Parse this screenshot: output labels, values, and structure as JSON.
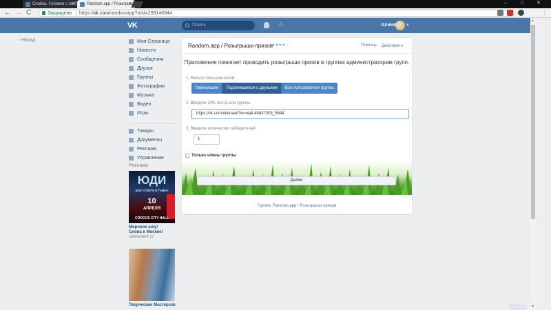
{
  "browser": {
    "tabs": [
      {
        "label": "Спайка. Готовим с люб"
      },
      {
        "label": "Random.app / Розыгрыш"
      }
    ],
    "secure_label": "Защищено",
    "url_prefix": "https://",
    "url_domain": "vk.com",
    "url_rest": "/randomapp?mid=299146944",
    "back_glyph": "←",
    "forward_glyph": "→",
    "reload_glyph": "C",
    "minimize_glyph": "–",
    "maximize_glyph": "□",
    "close_glyph": "✕",
    "tab_close_glyph": "×"
  },
  "vk": {
    "logo": "VK",
    "search_placeholder": "Поиск",
    "user_name": "Алина",
    "music_glyph": "♫",
    "chevron_glyph": "▾"
  },
  "back_link": "‹  Назад",
  "left_nav": {
    "primary": [
      {
        "label": "Моя Страница",
        "icon": "home-icon"
      },
      {
        "label": "Новости",
        "icon": "news-icon"
      },
      {
        "label": "Сообщения",
        "icon": "messages-icon"
      },
      {
        "label": "Друзья",
        "icon": "friends-icon"
      },
      {
        "label": "Группы",
        "icon": "groups-icon"
      },
      {
        "label": "Фотографии",
        "icon": "photos-icon"
      },
      {
        "label": "Музыка",
        "icon": "music-icon"
      },
      {
        "label": "Видео",
        "icon": "video-icon"
      },
      {
        "label": "Игры",
        "icon": "games-icon"
      }
    ],
    "secondary": [
      {
        "label": "Товары",
        "icon": "goods-icon"
      },
      {
        "label": "Документы",
        "icon": "documents-icon"
      },
      {
        "label": "Реклама",
        "icon": "ads-icon"
      },
      {
        "label": "Управление",
        "icon": "manage-icon"
      }
    ]
  },
  "ads": {
    "title": "Реклама",
    "ad1": {
      "headline": "ЮДИ",
      "subline": "шоу «Света и Тьмы»",
      "day": "10",
      "month": "АПРЕЛЯ",
      "venue": "CROCUS CITY HALL",
      "caption_line1": "Мировое шоу!",
      "caption_line2": "Снова в Москве!",
      "domain": "salesevent.ru"
    },
    "ad2": {
      "caption": "Творческие Мастерски"
    }
  },
  "app": {
    "title": "Random.app / Розыгрыши призов",
    "stars": "★★★★☆",
    "help": "Помощь",
    "actions": "Действия ▾",
    "intro": "Приложение помогает проводить розыгрыши призов в группах администраторам групп.",
    "filter_label": "1. Фильтр пользователей:",
    "filter_options": [
      "Лайкнувшие",
      "Поделившиеся с друзьями",
      "Все пользователи группы"
    ],
    "filter_selected_index": 1,
    "url_label": "2. Введите URL поста или группы",
    "url_value": "https://vk.com/oleinaoil?w=wall-49437303_5644",
    "count_label": "3. Введите количество победителей",
    "count_value": "1",
    "checkbox_label": "Только члены группы",
    "checkbox_checked": false,
    "next_button": "Далее",
    "footer": "Группа: Random.app / Розыгрыши призов"
  },
  "scrollbar": {
    "up_glyph": "▲",
    "down_glyph": "▼"
  },
  "colors": {
    "vk_header": "#4a76a8",
    "segment": "#4a86c5",
    "segment_selected": "#2e5f96",
    "link": "#285473"
  }
}
